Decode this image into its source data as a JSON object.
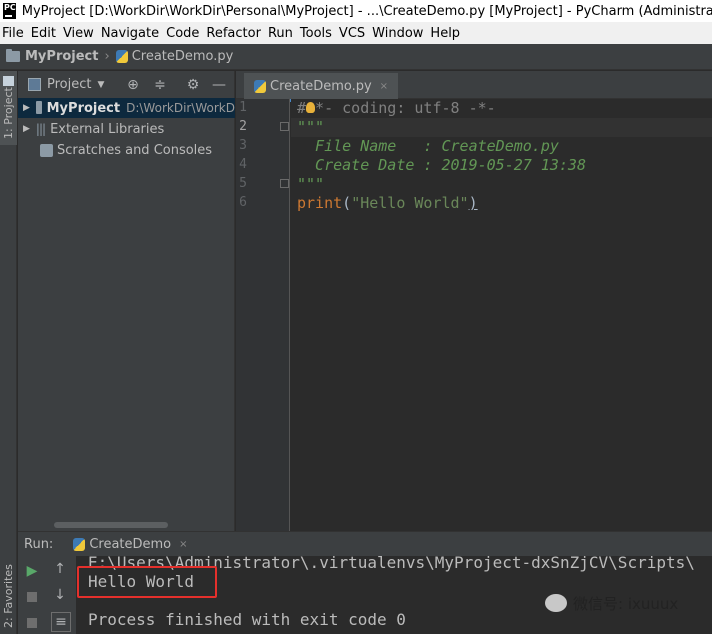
{
  "window": {
    "app_icon_text": "PC",
    "title": "MyProject [D:\\WorkDir\\WorkDir\\Personal\\MyProject] - ...\\CreateDemo.py [MyProject] - PyCharm (Administrator)"
  },
  "menu": [
    "File",
    "Edit",
    "View",
    "Navigate",
    "Code",
    "Refactor",
    "Run",
    "Tools",
    "VCS",
    "Window",
    "Help"
  ],
  "breadcrumb": {
    "project": "MyProject",
    "file": "CreateDemo.py"
  },
  "left_strip": {
    "project_label": "1: Project",
    "favorites_label": "2: Favorites"
  },
  "project_panel": {
    "view_selector": "Project",
    "tree": [
      {
        "label": "MyProject",
        "path": "D:\\WorkDir\\WorkD"
      },
      {
        "label": "External Libraries"
      },
      {
        "label": "Scratches and Consoles"
      }
    ]
  },
  "editor": {
    "tab_label": "CreateDemo.py",
    "line_numbers": [
      "1",
      "2",
      "3",
      "4",
      "5",
      "6"
    ],
    "lines": [
      "#-*- coding: utf-8 -*-",
      "\"\"\"",
      "  File Name   : CreateDemo.py",
      "  Create Date : 2019-05-27 13:38",
      "\"\"\"",
      "print(\"Hello World\")"
    ],
    "print_kw": "print",
    "print_open": "(",
    "print_str": "\"Hello World\"",
    "print_close": ")"
  },
  "run": {
    "label": "Run:",
    "config_name": "CreateDemo",
    "console_lines": [
      "E:\\Users\\Administrator\\.virtualenvs\\MyProject-dxSnZjCV\\Scripts\\",
      "Hello World",
      "",
      "Process finished with exit code 0"
    ]
  },
  "watermark": {
    "text": "微信号: ixuuux"
  },
  "colors": {
    "comment_green": "#629755",
    "keyword_orange": "#cc7832",
    "string_green": "#6a8759",
    "highlight_red": "#e5302c",
    "ide_bg": "#2b2b2b",
    "panel_bg": "#3c3f41"
  }
}
